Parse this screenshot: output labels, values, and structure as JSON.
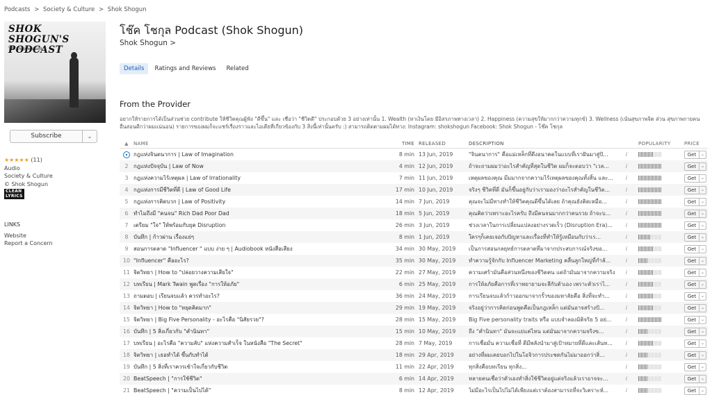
{
  "breadcrumb": [
    "Podcasts",
    ">",
    "Society & Culture",
    ">",
    "Shok Shogun"
  ],
  "artwork": {
    "line1": "SHOK SHOGUN'S",
    "line2": "PODCAST",
    "line3": "โช๊ค โชกุล พอดแคส"
  },
  "subscribe": {
    "label": "Subscribe",
    "dropdown": "⌄"
  },
  "meta": {
    "stars": "★★★★★",
    "rating_count": "(11)",
    "genre": "Audio",
    "category": "Society & Culture",
    "copyright": "© Shok Shogun",
    "clean_line1": "CLEAN",
    "clean_line2": "LYRICS"
  },
  "links": {
    "heading": "LINKS",
    "website": "Website",
    "report": "Report a Concern"
  },
  "podcast": {
    "title": "โช๊ค โชกุล Podcast (Shok Shogun)",
    "artist": "Shok Shogun >"
  },
  "tabs": [
    "Details",
    "Ratings and Reviews",
    "Related"
  ],
  "provider": {
    "heading": "From the Provider",
    "text": "อยากให้รายการได้เป็นส่วนช่วย contribute ให้ชีวิตคุณผู้ฟัง \"ดีขึ้น\" และ เชื่อว่า \"ชีวิตดี\" ประกอบด้วย 3 อย่างเท่านั้น 1. Wealth (หาเงินโดย มีอิสรภาพทางเวลา) 2. Happiness (ความสุขให้มากกว่าความทุกข์) 3. Wellness (เน้นสุขภาพจิต ส่วน สุขภาพกายคนอื่นสอนดีกว่าผมแน่นอน) รายการของผมก็จะแชร์เรื่องราวและไอเดียที่เกี่ยวข้องกับ 3 สิ่งนี้เท่านั้นครับ :) สามารถติดตามผมได้ทาง: Instagram: shokshogun Facebook: Shok Shogun - โช๊ค โชกุล"
  },
  "table": {
    "headers": {
      "sort": "▲",
      "name": "NAME",
      "time": "TIME",
      "released": "RELEASED",
      "description": "DESCRIPTION",
      "popularity": "POPULARITY",
      "price": "PRICE"
    },
    "get_label": "Get",
    "info_glyph": "i",
    "dd_glyph": "⌄",
    "rows": [
      {
        "idx": "",
        "name": "กฎแห่งจินตนาการ | Law of Imagination",
        "time": "8 min",
        "released": "13 Jun, 2019",
        "desc": "\"จินตนาการ\" คือแม่เหล็กที่ดึงอนาคตในแบบที่เราฝันมาสู่ปั...",
        "pop": 0.62
      },
      {
        "idx": "2",
        "name": "กฎแห่งปัจจุบัน | Law of Now",
        "time": "4 min",
        "released": "12 Jun, 2019",
        "desc": "ถ้าจะถามผมว่าอะไรสำคัญที่สุดในชีวิต ผมก็จะตอบว่า \"เวล...",
        "pop": 1.0
      },
      {
        "idx": "3",
        "name": "กฎแห่งความไร้เหตุผล | Law of Irrationality",
        "time": "7 min",
        "released": "11 Jun, 2019",
        "desc": "เหตุผลของคุณ มีมมากจากความไร้เหตุผลของคุณทั้งสิ้น และ...",
        "pop": 1.0
      },
      {
        "idx": "4",
        "name": "กฎแห่งการมีชีวิตที่ดี | Law of Good Life",
        "time": "17 min",
        "released": "10 Jun, 2019",
        "desc": "จริงๆ ชีวิตที่ดี มันก็ขึ้นอยู่กับว่าเรามองว่าอะไรสำคัญในชีวิต...",
        "pop": 1.0
      },
      {
        "idx": "5",
        "name": "กฎแห่งการคิดบวก | Law of Positivity",
        "time": "14 min",
        "released": "7 Jun, 2019",
        "desc": "คุณจะไม่มีทางทำให้ชีวิตคุณดีขึ้นได้เลย ถ้าคุณยังคิดเหมือ...",
        "pop": 1.0
      },
      {
        "idx": "6",
        "name": "ทำไมถึงมี \"คนจน\" Rich Dad Poor Dad",
        "time": "18 min",
        "released": "5 Jun, 2019",
        "desc": "คุณคิดว่าเพราะอะไรครับ ถึงมีคนจนมากกว่าคนรวย ถ้าจะบ...",
        "pop": 1.0
      },
      {
        "idx": "7",
        "name": "เตรียม \"ใจ\" ให้พร้อมกับยุค Disruption",
        "time": "26 min",
        "released": "3 Jun, 2019",
        "desc": "ช่วงเวลาในการเปลี่ยนแปลงอย่างรวดเร็ว (Disruption Era)...",
        "pop": 1.0
      },
      {
        "idx": "8",
        "name": "บันทึก | ก้าวผ่าน เรื่องแย่ๆ",
        "time": "8 min",
        "released": "1 Jun, 2019",
        "desc": "ใครๆก็เคยเจอกับปัญหาและเรื่องที่ทำให้รู้เหมือนกับว่าเร...",
        "pop": 0.5
      },
      {
        "idx": "9",
        "name": "สอนการตลาด \"Influencer \" แบบ ง่าย ๆ | Audiobook หนังสือเสียง",
        "time": "34 min",
        "released": "30 May, 2019",
        "desc": "เป็นการสอนกลยุทธ์การตลาดที่มาจากประสบการณ์จริงขอ...",
        "pop": 0.62
      },
      {
        "idx": "10",
        "name": "\"Influencer\" คืออะไร?",
        "time": "35 min",
        "released": "30 May, 2019",
        "desc": "ทำความรู้จักกับ Influencer Marketing คลื่นลูกใหญ่ที่กำลั...",
        "pop": 0.38
      },
      {
        "idx": "11",
        "name": "จิตวิทยา | How to \"ปล่อยวางความเสียใจ\"",
        "time": "22 min",
        "released": "27 May, 2019",
        "desc": "ความเศร้ามันคือส่วนหนึ่งของชีวิตคน แต่ถ้ามันมาจากความจริง...",
        "pop": 0.62
      },
      {
        "idx": "12",
        "name": "บทเรียน | Mark Twain พูดเรื่อง \"การให้อภัย\"",
        "time": "6 min",
        "released": "25 May, 2019",
        "desc": "การให้อภัยคือการที่เราพยายามจะลึกับตัวเอง เพราะตัวเราไ...",
        "pop": 0.62
      },
      {
        "idx": "13",
        "name": "ถามตอบ | เรียนจบแล้ว ควรทำอะไร?",
        "time": "36 min",
        "released": "24 May, 2019",
        "desc": "การเรียนจบแล้วก้าวออกมาจากรั้วของมหาลัยคือ สิ่งที่จะทำ...",
        "pop": 0.62
      },
      {
        "idx": "14",
        "name": "จิตวิทยา | How to \"หยุดคิดมาก\"",
        "time": "29 min",
        "released": "19 May, 2019",
        "desc": "จริงอยู่ว่าการคิดก่อนพูดคือเป็นกฎเหล็ก แต่มันอาจสร้างปั...",
        "pop": 0.62
      },
      {
        "idx": "15",
        "name": "จิตวิทยา | Big Five Personality - อะไรคือ \"นิสัยรวย\"?",
        "time": "28 min",
        "released": "15 May, 2019",
        "desc": "Big Five personality traits หรือ แบบจำลองมิติจริย 5 อย่...",
        "pop": 1.0
      },
      {
        "idx": "16",
        "name": "บันทึก | 5 สิ่งเกี่ยวกับ \"คำนินทา\"",
        "time": "15 min",
        "released": "10 May, 2019",
        "desc": "ถึง \"คำนินทา\" มันจะแย่แค่ไหน แต่มันมาจากความจริงข...",
        "pop": 0.38
      },
      {
        "idx": "17",
        "name": "บทเรียน | อะไรคือ \"ความลับ\" แห่งความสำเร็จ ในหนังสือ \"The Secret\"",
        "time": "28 min",
        "released": "7 May, 2019",
        "desc": "การเชื่อมั่น ความเชื่อที่ ดีมีพลังนำมาสู่เป้าหมายที่ดีและเส้นท...",
        "pop": 0.62
      },
      {
        "idx": "18",
        "name": "จิตวิทยา | เธอทำได้ ขึ้นกับทำได้",
        "time": "18 min",
        "released": "29 Apr, 2019",
        "desc": "อย่างที่ผมเคยบอกไปในโอจิวการประชดกันไม่มาออกว่าสิ่...",
        "pop": 0.38
      },
      {
        "idx": "19",
        "name": "บันทึก | 5 สิ่งที่เราควรเข้าใจเกี่ยวกับชีวิต",
        "time": "11 min",
        "released": "22 Apr, 2019",
        "desc": "ทุกสิ่งคือบทเรียน ทุกสิ่ง...",
        "pop": 0.38
      },
      {
        "idx": "20",
        "name": "BeatSpeech | \"การใช้ชีวิต\"",
        "time": "6 min",
        "released": "14 Apr, 2019",
        "desc": "หลายคนเชื่อว่าตัวเองทำสิ่งใช้ชีวิตอยู่แต่จริงแล้วเราอาจจะ...",
        "pop": 0.38
      },
      {
        "idx": "21",
        "name": "BeatSpeech | \"ความเป็นไปได้\"",
        "time": "8 min",
        "released": "12 Apr, 2019",
        "desc": "ไม่มีอะไรเป็นไปไม่ได้เพียงแต่เราต้องสามารถที่จะวิเคราะห์...",
        "pop": 0.38
      }
    ]
  }
}
